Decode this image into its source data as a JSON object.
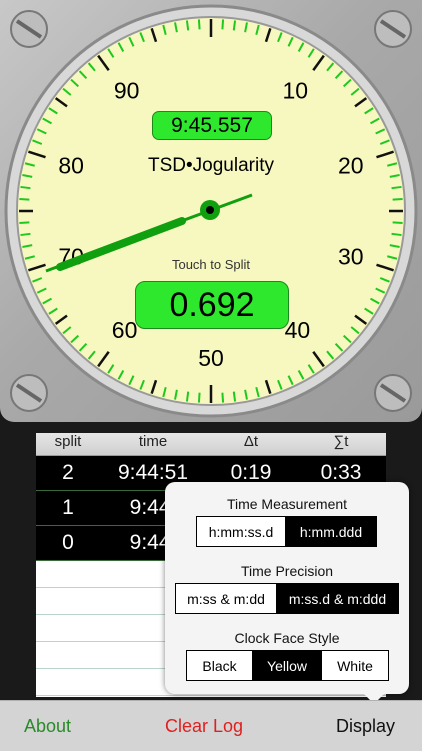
{
  "dial": {
    "numbers": [
      "90",
      "10",
      "80",
      "20",
      "70",
      "30",
      "60",
      "40",
      "50"
    ],
    "face_color": "#f7f7c0",
    "tick_color": "#1ec81e",
    "needle_color": "#0f9f0f"
  },
  "timer": {
    "time_of_day": "9:45.557",
    "brand": "TSD•Jogularity",
    "hint": "Touch to Split",
    "split_value": "0.692"
  },
  "log": {
    "headers": [
      "split",
      "time",
      "Δt",
      "∑t"
    ],
    "rows": [
      {
        "split": "2",
        "time": "9:44:51",
        "dt": "0:19",
        "st": "0:33"
      },
      {
        "split": "1",
        "time": "9:44:",
        "dt": "",
        "st": ""
      },
      {
        "split": "0",
        "time": "9:44:",
        "dt": "",
        "st": ""
      }
    ]
  },
  "display_settings": {
    "time_measurement": {
      "title": "Time Measurement",
      "options": [
        "h:mm:ss.d",
        "h:mm.ddd"
      ],
      "selected": "h:mm.ddd"
    },
    "time_precision": {
      "title": "Time Precision",
      "options": [
        "m:ss & m:dd",
        "m:ss.d & m:ddd"
      ],
      "selected": "m:ss.d & m:ddd"
    },
    "clock_face": {
      "title": "Clock Face Style",
      "options": [
        "Black",
        "Yellow",
        "White"
      ],
      "selected": "Yellow"
    }
  },
  "toolbar": {
    "about": "About",
    "clear_log": "Clear Log",
    "display": "Display",
    "about_color": "#2a8a2a",
    "clear_color": "#e02020"
  }
}
